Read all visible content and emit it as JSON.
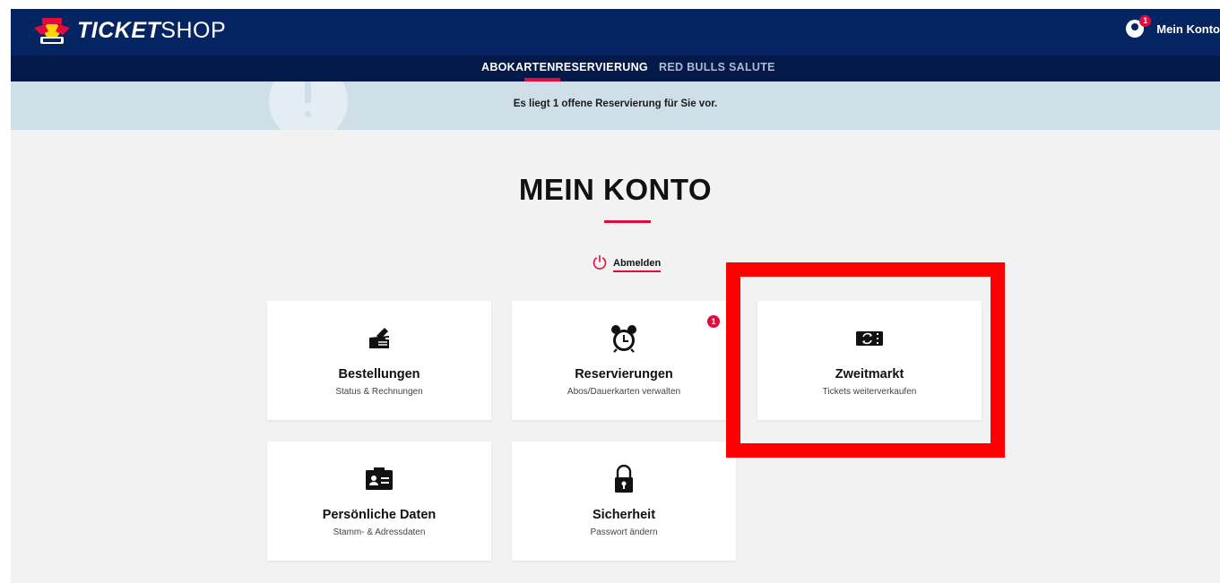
{
  "header": {
    "logo_text_bold": "TICKET",
    "logo_text_light": "SHOP",
    "account_label": "Mein Konto",
    "account_badge": "1"
  },
  "nav": {
    "items": [
      {
        "label": "ABOKARTENRESERVIERUNG",
        "active": true
      },
      {
        "label": "RED BULLS SALUTE",
        "active": false
      }
    ]
  },
  "notice": {
    "text": "Es liegt 1 offene Reservierung für Sie vor."
  },
  "main": {
    "title": "MEIN KONTO",
    "logout_label": "Abmelden",
    "tiles": [
      {
        "icon": "order-edit-icon",
        "title": "Bestellungen",
        "subtitle": "Status & Rechnungen"
      },
      {
        "icon": "alarm-clock-icon",
        "title": "Reservierungen",
        "subtitle": "Abos/Dauerkarten verwalten",
        "badge": "1"
      },
      {
        "icon": "ticket-exchange-icon",
        "title": "Zweitmarkt",
        "subtitle": "Tickets weiterverkaufen"
      },
      {
        "icon": "id-card-icon",
        "title": "Persönliche Daten",
        "subtitle": "Stamm- & Adressdaten"
      },
      {
        "icon": "lock-icon",
        "title": "Sicherheit",
        "subtitle": "Passwort ändern"
      }
    ]
  },
  "colors": {
    "header_bg": "#042561",
    "nav_bg": "#02194a",
    "accent": "#e30b3c",
    "notice_bg": "#cfdfe8",
    "highlight": "#ff0000"
  }
}
